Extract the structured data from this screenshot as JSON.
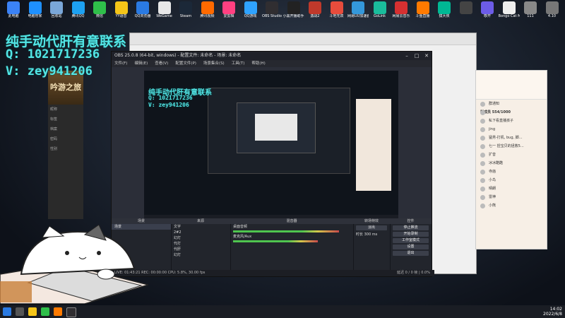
{
  "desktop_icons": [
    {
      "label": "此电脑",
      "color": "#3b82f6"
    },
    {
      "label": "电脑管家",
      "color": "#1e90ff"
    },
    {
      "label": "回收站",
      "color": "#7aa7d9"
    },
    {
      "label": "腾讯QQ",
      "color": "#1da1f2"
    },
    {
      "label": "微信",
      "color": "#2fbf4a"
    },
    {
      "label": "YY语音",
      "color": "#f5c518"
    },
    {
      "label": "QQ浏览器",
      "color": "#2a7ae2"
    },
    {
      "label": "WeGame",
      "color": "#e8e8e8"
    },
    {
      "label": "Steam",
      "color": "#1b2838"
    },
    {
      "label": "腾讯视频",
      "color": "#ff6a00"
    },
    {
      "label": "爱剪辑",
      "color": "#ff4081"
    },
    {
      "label": "QQ游戏",
      "color": "#2fa3ff"
    },
    {
      "label": "OBS Studio",
      "color": "#302e31"
    },
    {
      "label": "小黑开播助手",
      "color": "#222222"
    },
    {
      "label": "激战2",
      "color": "#c0392b"
    },
    {
      "label": "斗地无双",
      "color": "#e74c3c"
    },
    {
      "label": "网易UU加速器",
      "color": "#3498db"
    },
    {
      "label": "GoLink",
      "color": "#1abc9c"
    },
    {
      "label": "网易云音乐",
      "color": "#d63031"
    },
    {
      "label": "斗鱼直播",
      "color": "#ff7a00"
    },
    {
      "label": "猿大侠",
      "color": "#00b894"
    },
    {
      "label": "",
      "color": "#444"
    },
    {
      "label": "哆开",
      "color": "#6c5ce7"
    },
    {
      "label": "Bongo Cat Mver",
      "color": "#eeeeee"
    },
    {
      "label": "111",
      "color": "#888"
    },
    {
      "label": "4.10",
      "color": "#777"
    }
  ],
  "overlay": {
    "line1": "纯手动代肝有意联系",
    "line2": "Q: 1021717236",
    "line3": "V: zey941206"
  },
  "obs_window": {
    "title": "OBS 25.0.8 (64-bit, windows) - 配置文件: 未命名 - 场景: 未命名",
    "menu": [
      "文件(F)",
      "编辑(E)",
      "查看(V)",
      "配置文件(P)",
      "场景集合(S)",
      "工具(T)",
      "帮助(H)"
    ],
    "docks": {
      "scenes": {
        "header": "场景",
        "items": [
          "场景"
        ]
      },
      "sources": {
        "header": "来源",
        "items": [
          "文字",
          "2#2",
          "幻灯",
          "代打",
          "代肝",
          "幻灯"
        ]
      },
      "mixer": {
        "header": "混音器",
        "tracks": [
          {
            "name": "桌面音频",
            "level": "0.0 dB"
          },
          {
            "name": "麦克风/Aux",
            "level": "0.0 dB"
          }
        ]
      },
      "transitions": {
        "header": "转场特效",
        "mode": "淡出",
        "duration_label": "时长",
        "duration": "300 ms"
      },
      "controls": {
        "header": "控件",
        "buttons": [
          "停止推流",
          "开始录制",
          "工作室模式",
          "设置",
          "退出"
        ]
      }
    },
    "status": "LIVE: 01:43:21  REC: 00:00:00  CPU: 5.8%, 30.00 fps",
    "status_right": "延迟 0 / 0 帧 | 0.0%"
  },
  "right_panel": {
    "group_name": "群通知",
    "members_label": "群成员 554/1000",
    "members": [
      "私下看直播孩子",
      "jing",
      "猛男-打机, bug, 脚…",
      "七一 捏宝贝的拯救5…",
      "扩音",
      "冰冰酷酷",
      "寺庙",
      "小鸟",
      "晴朗",
      "雷神",
      "小熊"
    ]
  },
  "left_app": {
    "banner_text": "吟游之旅",
    "labels": [
      "昵称",
      "标签",
      "档案",
      "密码",
      "性别"
    ]
  },
  "taskbar": {
    "clock_time": "14:02",
    "clock_date": "2022/6/8"
  }
}
